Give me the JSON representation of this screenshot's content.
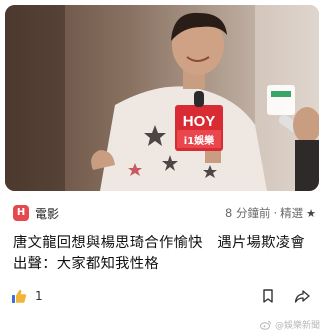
{
  "card": {
    "source_badge": "H",
    "source_name": "電影",
    "time": "8 分鐘前",
    "separator": " · ",
    "tag": "精選",
    "star_glyph": "★",
    "headline": "唐文龍回想與楊思琦合作愉快　遇片場欺凌會出聲：大家都知我性格",
    "likes": "1",
    "accent_color": "#e5484d"
  },
  "hero": {
    "mic_text_top": "HOY",
    "mic_text_bottom": "i1娛樂"
  },
  "watermark": {
    "text": "@娛樂新聞"
  }
}
